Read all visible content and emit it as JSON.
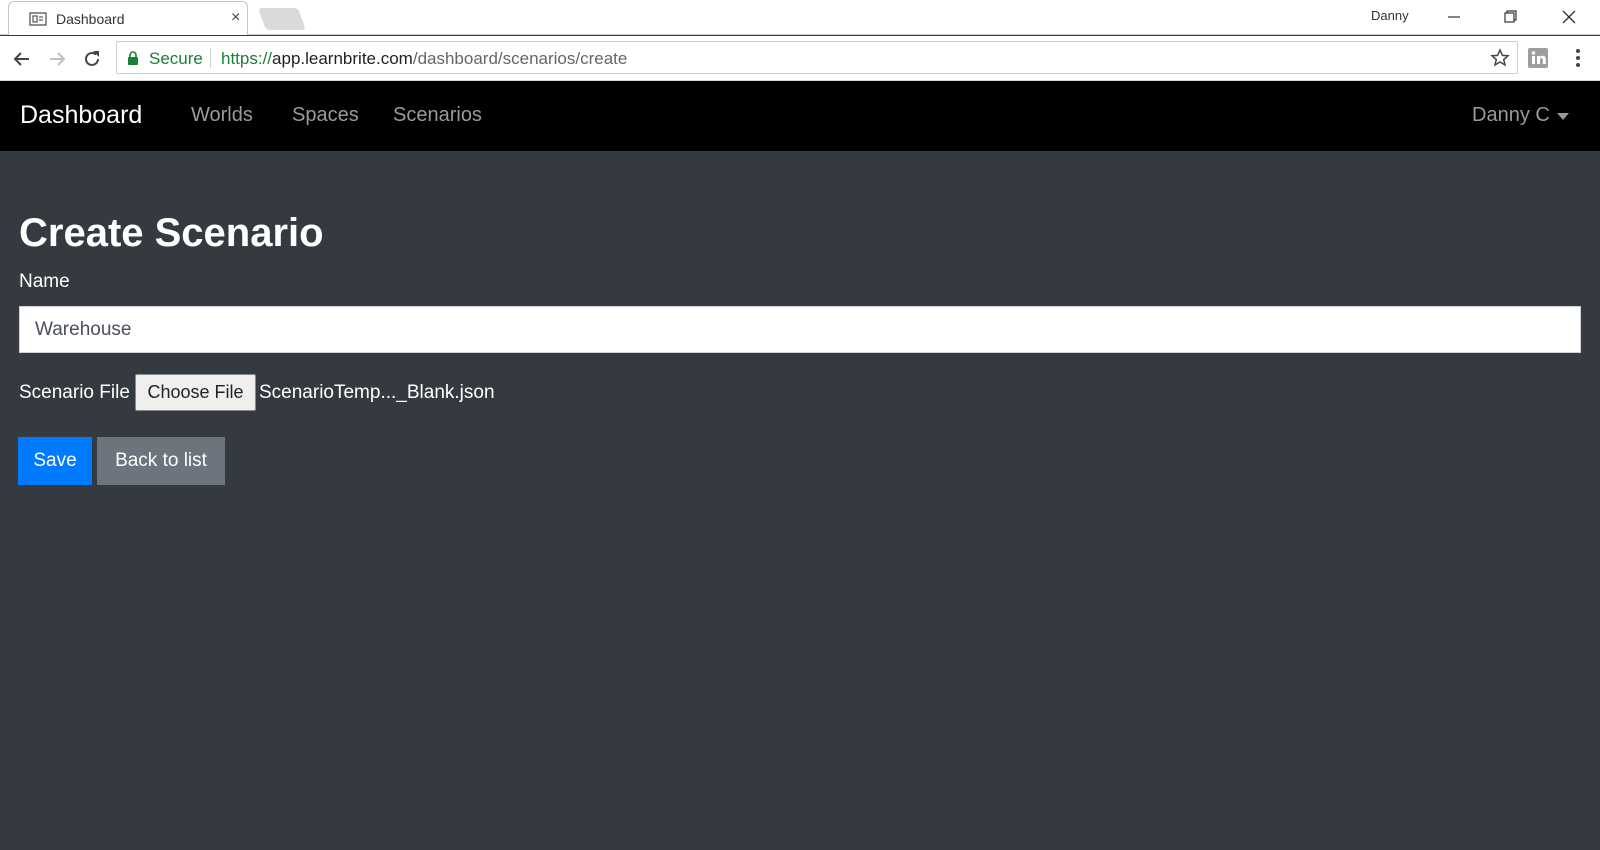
{
  "browser": {
    "tab_title": "Dashboard",
    "tab_close": "×",
    "profile_name": "Danny",
    "secure_label": "Secure",
    "url_scheme": "https://",
    "url_host": "app.learnbrite.com",
    "url_path": "/dashboard/scenarios/create",
    "icons": [
      "page-icon",
      "close-icon",
      "back-arrow-icon",
      "forward-arrow-icon",
      "reload-icon",
      "lock-icon",
      "star-icon",
      "linkedin-icon",
      "kebab-menu-icon",
      "minimize-icon",
      "restore-icon",
      "close-window-icon"
    ]
  },
  "navbar": {
    "brand": "Dashboard",
    "links": [
      "Worlds",
      "Spaces",
      "Scenarios"
    ],
    "user": "Danny C"
  },
  "form": {
    "title": "Create Scenario",
    "name_label": "Name",
    "name_value": "Warehouse",
    "file_label": "Scenario File",
    "file_button": "Choose File",
    "file_name": "ScenarioTemp..._Blank.json",
    "save_label": "Save",
    "back_label": "Back to list"
  },
  "colors": {
    "page_bg": "#343a40",
    "navbar_bg": "#000000",
    "primary": "#007bff",
    "secondary": "#6c757d",
    "secure_green": "#188038"
  }
}
